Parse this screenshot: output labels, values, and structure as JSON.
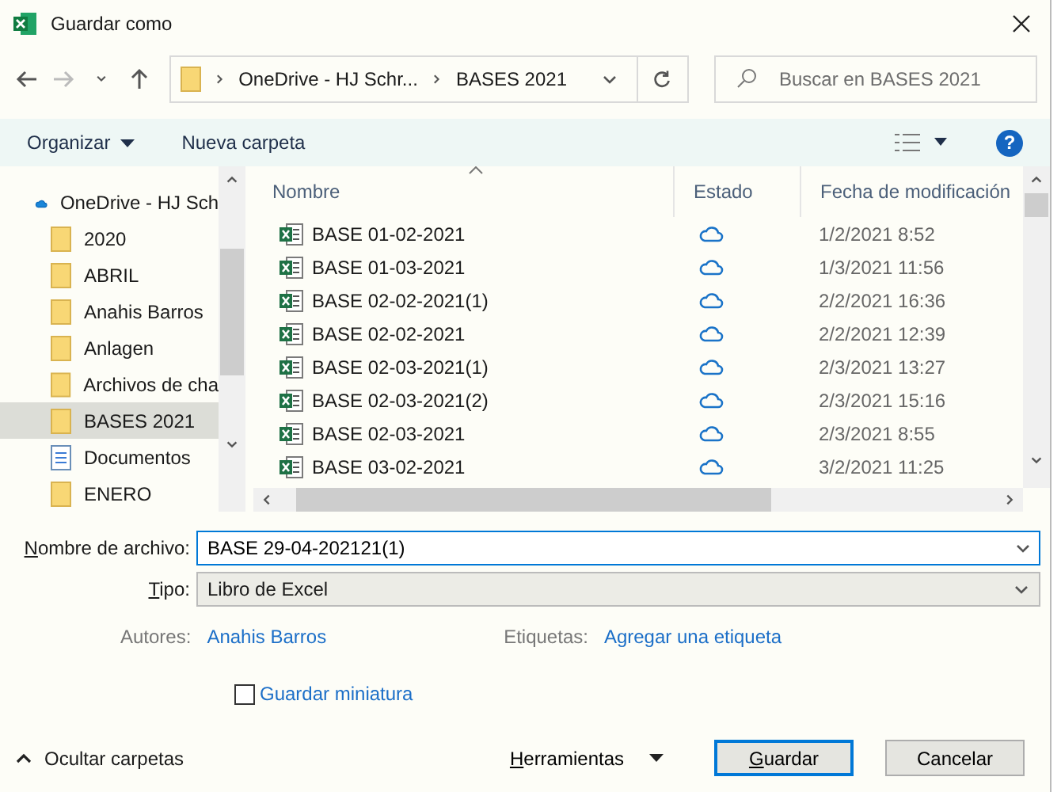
{
  "window": {
    "title": "Guardar como"
  },
  "address": {
    "crumbs": [
      "OneDrive - HJ Schr...",
      "BASES 2021"
    ]
  },
  "search": {
    "placeholder": "Buscar en BASES 2021"
  },
  "toolbar": {
    "organize": "Organizar",
    "new_folder": "Nueva carpeta",
    "help": "?"
  },
  "sidebar": {
    "items": [
      {
        "label": "OneDrive - HJ Sch",
        "kind": "cloud",
        "selected": false
      },
      {
        "label": "2020",
        "kind": "folder",
        "selected": false
      },
      {
        "label": "ABRIL",
        "kind": "folder",
        "selected": false
      },
      {
        "label": "Anahis Barros",
        "kind": "folder",
        "selected": false
      },
      {
        "label": "Anlagen",
        "kind": "folder",
        "selected": false
      },
      {
        "label": "Archivos de cha",
        "kind": "folder",
        "selected": false
      },
      {
        "label": "BASES 2021",
        "kind": "folder",
        "selected": true
      },
      {
        "label": "Documentos",
        "kind": "document",
        "selected": false
      },
      {
        "label": "ENERO",
        "kind": "folder",
        "selected": false
      }
    ]
  },
  "table": {
    "columns": [
      "Nombre",
      "Estado",
      "Fecha de modificación"
    ],
    "rows": [
      {
        "name": "BASE 01-02-2021",
        "date": "1/2/2021 8:52"
      },
      {
        "name": "BASE 01-03-2021",
        "date": "1/3/2021 11:56"
      },
      {
        "name": "BASE 02-02-2021(1)",
        "date": "2/2/2021 16:36"
      },
      {
        "name": "BASE 02-02-2021",
        "date": "2/2/2021 12:39"
      },
      {
        "name": "BASE 02-03-2021(1)",
        "date": "2/3/2021 13:27"
      },
      {
        "name": "BASE 02-03-2021(2)",
        "date": "2/3/2021 15:16"
      },
      {
        "name": "BASE 02-03-2021",
        "date": "2/3/2021 8:55"
      },
      {
        "name": "BASE 03-02-2021",
        "date": "3/2/2021 11:25"
      }
    ]
  },
  "form": {
    "filename_label": "Nombre de archivo:",
    "filename": "BASE 29-04-202121(1)",
    "type_label": "Tipo:",
    "type": "Libro de Excel",
    "authors_label": "Autores:",
    "authors": "Anahis Barros",
    "tags_label": "Etiquetas:",
    "tags": "Agregar una etiqueta",
    "thumbnail": {
      "label": "Guardar miniatura",
      "checked": false
    }
  },
  "footer": {
    "hide_folders": "Ocultar carpetas",
    "tools": "Herramientas",
    "save": "Guardar",
    "cancel": "Cancelar"
  }
}
